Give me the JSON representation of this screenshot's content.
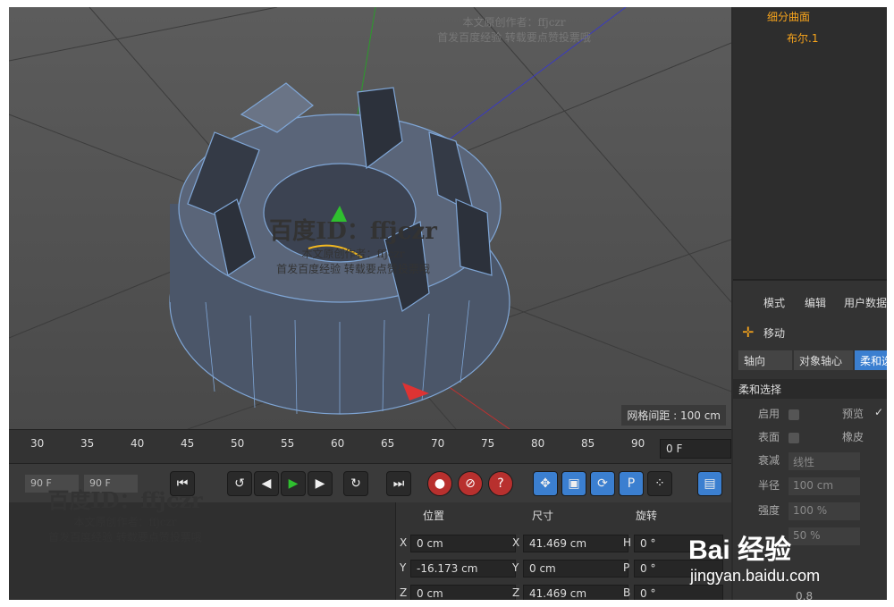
{
  "viewport": {
    "grid_spacing": "网格间距 : 100 cm"
  },
  "timeline": {
    "ticks": [
      "30",
      "35",
      "40",
      "45",
      "50",
      "55",
      "60",
      "65",
      "70",
      "75",
      "80",
      "85",
      "90"
    ],
    "frame_value": "0 F"
  },
  "playback": {
    "start_field": "90 F",
    "end_field": "90 F"
  },
  "coords": {
    "headers": {
      "pos": "位置",
      "size": "尺寸",
      "rot": "旋转"
    },
    "rows": [
      {
        "pl": "X",
        "pv": "0 cm",
        "sl": "X",
        "sv": "41.469 cm",
        "rl": "H",
        "rv": "0 °"
      },
      {
        "pl": "Y",
        "pv": "-16.173 cm",
        "sl": "Y",
        "sv": "0 cm",
        "rl": "P",
        "rv": "0 °"
      },
      {
        "pl": "Z",
        "pv": "0 cm",
        "sl": "Z",
        "sv": "41.469 cm",
        "rl": "B",
        "rv": "0 °"
      }
    ]
  },
  "objects": {
    "parent": "细分曲面",
    "child": "布尔.1"
  },
  "attributes": {
    "menu": [
      "模式",
      "编辑",
      "用户数据"
    ],
    "tool": "移动",
    "tabs": [
      "轴向",
      "对象轴心",
      "柔和选择"
    ],
    "section": "柔和选择",
    "enable": "启用",
    "preview": "预览",
    "surface": "表面",
    "rubber": "橡皮",
    "falloff": "衰减",
    "falloff_value": "线性",
    "radius": "半径",
    "radius_value": "100 cm",
    "strength": "强度",
    "strength_value": "100 %",
    "width_value": "50 %",
    "bottom_value": "0.8"
  },
  "watermarks": {
    "id": "百度ID：ffjczr",
    "author": "本文原创作者：ffjczr",
    "note": "首发百度经验 转载要点赞投票哦",
    "brand": "Bai 经验",
    "url": "jingyan.baidu.com"
  },
  "colors": {
    "accent": "#f7a41c",
    "viewport": "#555555",
    "select": "#3b7fd0"
  }
}
